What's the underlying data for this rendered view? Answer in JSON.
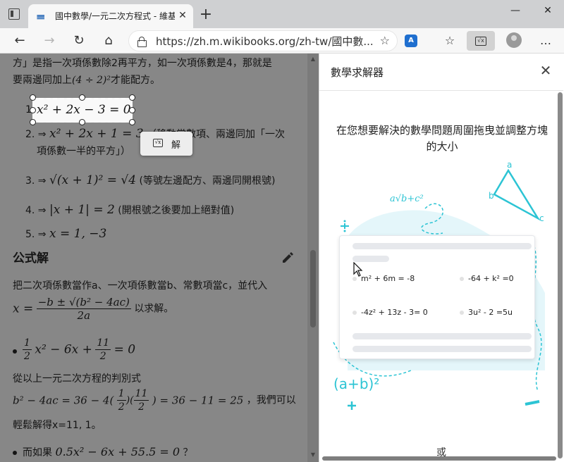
{
  "tab": {
    "title": "國中數學/一元二次方程式 - 維基",
    "close": "✕"
  },
  "window": {
    "minimize": "—",
    "maximize": "☐",
    "close": "✕"
  },
  "address": {
    "url": "https://zh.m.wikibooks.org/zh-tw/國中數..."
  },
  "page": {
    "line1": "方」是指一次項係數除2再平方，如一次項係數是4，那就是",
    "line2_pre": "要兩邊同加上",
    "line2_math": "(4 ÷ 2)²",
    "line2_post": "才能配方。",
    "step1_num": "1.",
    "step1_math": "x² + 2x − 3 = 0",
    "step2_num": "2. ⇒",
    "step2_math": "x² + 2x + 1 = 3",
    "step2_text": "（移動常數項、兩邊同加「一次",
    "step2_text2": "項係數一半的平方」）",
    "step3_num": "3. ⇒",
    "step3_math": "√(x + 1)² = √4",
    "step3_text": "(等號左邊配方、兩邊同開根號)",
    "step4_num": "4. ⇒",
    "step4_math": "|x + 1| = 2",
    "step4_text": "(開根號之後要加上絕對值)",
    "step5_num": "5. ⇒",
    "step5_math": "x = 1, −3",
    "heading": "公式解",
    "formula_intro": "把二次項係數當作a、一次項係數當b、常數項當c，並代入",
    "formula_lhs": "x =",
    "formula_num": "−b ± √(b² − 4ac)",
    "formula_den": "2a",
    "formula_post": "以求解。",
    "bullet1_a_num": "1",
    "bullet1_a_den": "2",
    "bullet1_mid": "x² − 6x +",
    "bullet1_b_num": "11",
    "bullet1_b_den": "2",
    "bullet1_end": "= 0",
    "discriminant_label": "從以上一元二次方程的判別式",
    "disc_math_a": "b² − 4ac = 36 − 4(",
    "disc_f1_num": "1",
    "disc_f1_den": "2",
    "disc_f2_num": "11",
    "disc_f2_den": "2",
    "disc_math_b": ") = 36 − 11 = 25",
    "disc_text": "，我們可以",
    "disc_text2": "輕鬆解得x=11, 1。",
    "bullet2_pre": "而如果",
    "bullet2_math": "0.5x² − 6x + 55.5 = 0",
    "bullet2_post": "？",
    "solve_label": "解"
  },
  "pane": {
    "title": "數學求解器",
    "instruction": "在您想要解決的數學問題周圍拖曳並調整方塊的大小",
    "equations": [
      "m² + 6m = -8",
      "-64 + k² =0",
      "-4z² + 13z - 3= 0",
      "3u² - 2  =5u"
    ],
    "or_text": "或",
    "illus_sqrt": "a√b+c²",
    "illus_ab": "(a+b)²",
    "illus_tri_a": "a",
    "illus_tri_b": "b",
    "illus_tri_c": "c"
  },
  "colors": {
    "accent": "#2cc4d4",
    "dim": "#878787"
  }
}
